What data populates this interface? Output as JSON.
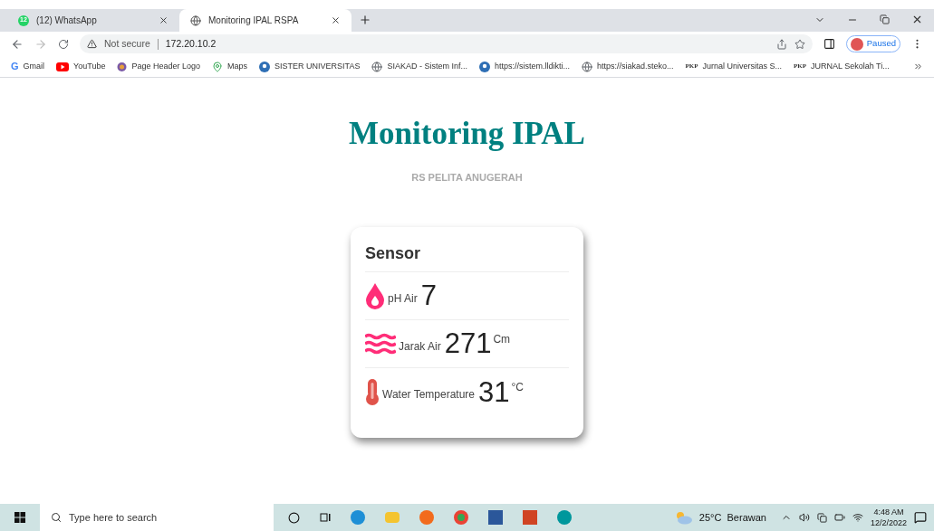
{
  "tabs": [
    {
      "label": "(12) WhatsApp",
      "badge": "12",
      "selected": false
    },
    {
      "label": "Monitoring IPAL RSPA",
      "selected": true
    }
  ],
  "address_bar": {
    "security": "Not secure",
    "url": "172.20.10.2"
  },
  "profile": {
    "status": "Paused"
  },
  "bookmarks": [
    {
      "label": "Gmail",
      "kind": "gmail",
      "icon_text": "G"
    },
    {
      "label": "YouTube",
      "kind": "youtube"
    },
    {
      "label": "Page Header Logo",
      "kind": "logo"
    },
    {
      "label": "Maps",
      "kind": "maps"
    },
    {
      "label": "SISTER UNIVERSITAS",
      "kind": "edu"
    },
    {
      "label": "SIAKAD - Sistem Inf...",
      "kind": "globe"
    },
    {
      "label": "https://sistem.lldikti...",
      "kind": "edu"
    },
    {
      "label": "https://siakad.steko...",
      "kind": "globe"
    },
    {
      "label": "Jurnal Universitas S...",
      "kind": "pkp",
      "icon_text": "PKP"
    },
    {
      "label": "JURNAL Sekolah Ti...",
      "kind": "pkp",
      "icon_text": "PKP"
    }
  ],
  "page": {
    "title": "Monitoring IPAL",
    "subtitle": "RS PELITA ANUGERAH",
    "card": {
      "title": "Sensor",
      "rows": [
        {
          "kind": "drop",
          "label": "pH Air",
          "value": "7"
        },
        {
          "kind": "wave",
          "label": "Jarak Air",
          "value": "271",
          "unit": "Cm"
        },
        {
          "kind": "thermo",
          "label": "Water Temperature",
          "value": "31",
          "unit": "°C"
        }
      ]
    }
  },
  "taskbar": {
    "search_placeholder": "Type here to search",
    "weather": "25°C  Berawan",
    "time": "4:48 AM",
    "date": "12/2/2022"
  }
}
